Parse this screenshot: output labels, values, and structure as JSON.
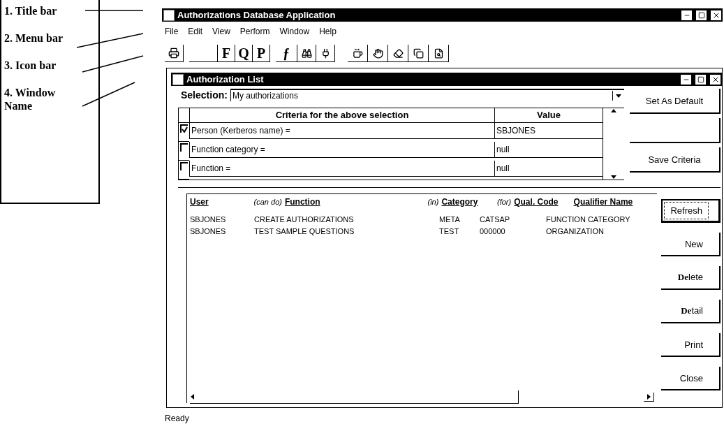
{
  "callouts": [
    {
      "label": "1. Title bar"
    },
    {
      "label": "2. Menu bar"
    },
    {
      "label": "3. Icon bar"
    },
    {
      "label": "4. Window Name"
    }
  ],
  "window": {
    "title": "Authorizations Database Application"
  },
  "menu": [
    "File",
    "Edit",
    "View",
    "Perform",
    "Window",
    "Help"
  ],
  "toolbar": {
    "letter_buttons": [
      "F",
      "Q",
      "P"
    ],
    "function_button": "ƒ"
  },
  "inner_window": {
    "title": "Authorization List",
    "selection": {
      "label": "Selection:",
      "value": "My authorizations"
    },
    "criteria": {
      "columns": [
        "Criteria for the above selection",
        "Value"
      ],
      "rows": [
        {
          "checked": true,
          "criterion": "Person (Kerberos name) =",
          "value": "SBJONES"
        },
        {
          "checked": false,
          "criterion": "Function category =",
          "value": "null"
        },
        {
          "checked": false,
          "criterion": "Function =",
          "value": "null"
        }
      ]
    },
    "criteria_buttons": [
      {
        "kind": "text",
        "label": "Set As Default"
      },
      {
        "kind": "blank"
      },
      {
        "kind": "text",
        "label": "Save Criteria"
      }
    ],
    "results": {
      "columns": [
        {
          "label": "User"
        },
        {
          "prefix": "(can do)",
          "label": "Function"
        },
        {
          "prefix": "(in)",
          "label": "Category"
        },
        {
          "prefix": "(for)",
          "label": "Qual. Code"
        },
        {
          "label": "Qualifier Name"
        }
      ],
      "rows": [
        [
          "SBJONES",
          "CREATE AUTHORIZATIONS",
          "META",
          "CATSAP",
          "FUNCTION CATEGORY"
        ],
        [
          "SBJONES",
          "TEST SAMPLE QUESTIONS",
          "TEST",
          "000000",
          "ORGANIZATION"
        ]
      ]
    },
    "buttons": [
      {
        "label": "Refresh",
        "focused": true
      },
      {
        "label": "New",
        "focused": false
      },
      {
        "label": "**De**lete",
        "focused": false
      },
      {
        "label": "**De**tail",
        "focused": false
      },
      {
        "label": "Print",
        "focused": false
      },
      {
        "label": "Close",
        "focused": false
      }
    ]
  },
  "status_bar": "Ready"
}
